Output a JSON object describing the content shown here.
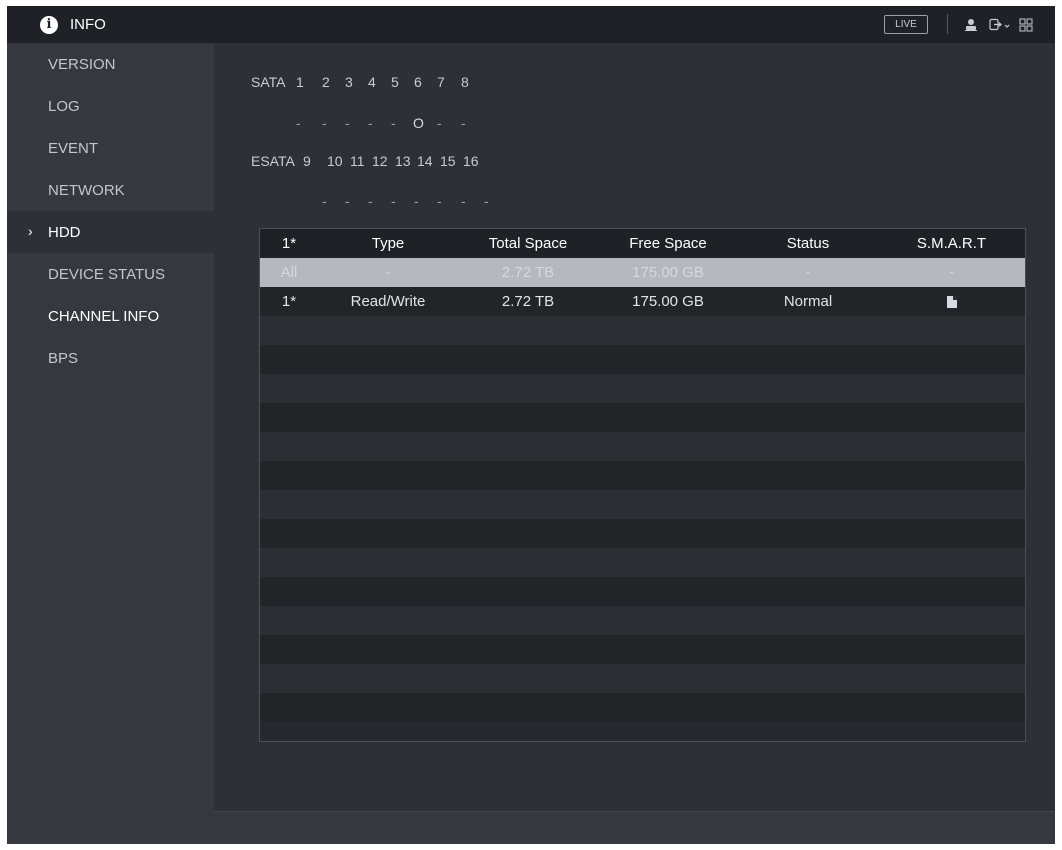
{
  "header": {
    "title": "INFO",
    "live_label": "LIVE"
  },
  "sidebar": {
    "items": [
      {
        "label": "VERSION"
      },
      {
        "label": "LOG"
      },
      {
        "label": "EVENT"
      },
      {
        "label": "NETWORK"
      },
      {
        "label": "HDD"
      },
      {
        "label": "DEVICE STATUS"
      },
      {
        "label": "CHANNEL INFO"
      },
      {
        "label": "BPS"
      }
    ],
    "selected": "HDD"
  },
  "ports": {
    "sata_label": "SATA",
    "sata_numbers": [
      "1",
      "2",
      "3",
      "4",
      "5",
      "6",
      "7",
      "8"
    ],
    "sata_status": [
      "-",
      "-",
      "-",
      "-",
      "-",
      "O",
      "-",
      "-"
    ],
    "esata_label": "ESATA",
    "esata_numbers": [
      "9",
      "10",
      "11",
      "12",
      "13",
      "14",
      "15",
      "16"
    ],
    "esata_status": [
      "-",
      "-",
      "-",
      "-",
      "-",
      "-",
      "-",
      "-"
    ]
  },
  "table": {
    "columns": [
      "1*",
      "Type",
      "Total Space",
      "Free Space",
      "Status",
      "S.M.A.R.T"
    ],
    "rows": [
      {
        "id": "All",
        "type": "-",
        "total": "2.72 TB",
        "free": "175.00 GB",
        "status": "-",
        "smart": "-"
      },
      {
        "id": "1*",
        "type": "Read/Write",
        "total": "2.72 TB",
        "free": "175.00 GB",
        "status": "Normal",
        "smart": "doc-icon"
      }
    ]
  }
}
